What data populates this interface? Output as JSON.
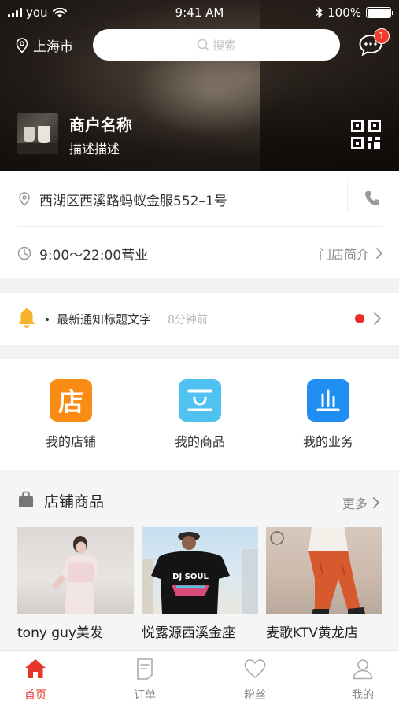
{
  "status_bar": {
    "carrier": "you",
    "time": "9:41 AM",
    "battery": "100%"
  },
  "header": {
    "city": "上海市",
    "search_placeholder": "搜索",
    "message_badge": "1",
    "shop_name": "商户名称",
    "shop_desc": "描述描述"
  },
  "info": {
    "address": "西湖区西溪路蚂蚁金服552–1号",
    "hours": "9:00～22:00营业",
    "intro_link": "门店简介"
  },
  "notice": {
    "title": "最新通知标题文字",
    "time": "8分钟前"
  },
  "quick_entries": [
    {
      "label": "我的店铺",
      "glyph": "店",
      "color": "#fb8c13",
      "icon": "store-icon"
    },
    {
      "label": "我的商品",
      "color": "#4fc2f1",
      "icon": "bag-icon"
    },
    {
      "label": "我的业务",
      "color": "#1f8df2",
      "icon": "chart-icon"
    }
  ],
  "products": {
    "section_title": "店铺商品",
    "more_label": "更多",
    "items": [
      {
        "name": "tony guy美发"
      },
      {
        "name": "悦露源西溪金座",
        "shirt_text": "DJ SOUL"
      },
      {
        "name": "麦歌KTV黄龙店"
      }
    ]
  },
  "tabbar": [
    {
      "label": "首页",
      "active": true
    },
    {
      "label": "订单",
      "active": false
    },
    {
      "label": "粉丝",
      "active": false
    },
    {
      "label": "我的",
      "active": false
    }
  ],
  "colors": {
    "accent": "#e8352a",
    "notice_dot": "#ee2a2a",
    "bell": "#f5b22b"
  }
}
